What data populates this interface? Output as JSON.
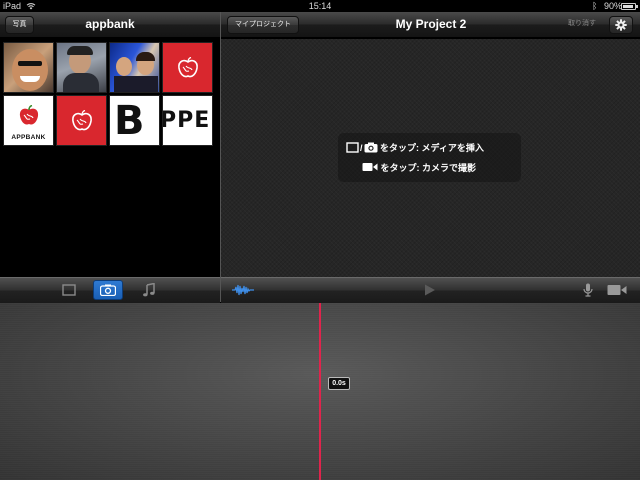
{
  "status_bar": {
    "carrier": "iPad",
    "time": "15:14",
    "battery_text": "90%",
    "battery_level": 0.9
  },
  "media_browser": {
    "back_button_label": "写真",
    "title": "appbank",
    "thumbnails": [
      {
        "kind": "photo"
      },
      {
        "kind": "photo"
      },
      {
        "kind": "photo"
      },
      {
        "kind": "apple-logo"
      },
      {
        "kind": "appbank-logo",
        "text": "APPBANK"
      },
      {
        "kind": "apple-logo"
      },
      {
        "kind": "letter",
        "text": "B"
      },
      {
        "kind": "letters",
        "text": "PPE"
      }
    ],
    "tabs": [
      "video",
      "photo",
      "music"
    ],
    "active_tab": "photo"
  },
  "project": {
    "my_projects_label": "マイプロジェクト",
    "title": "My Project 2",
    "undo_label": "取り消す",
    "hint_line1": "をタップ: メディアを挿入",
    "hint_line2": "をタップ: カメラで撮影"
  },
  "timeline": {
    "time_label": "0.0s"
  },
  "colors": {
    "accent_blue": "#2f7ad2",
    "playhead_red": "#e0244c",
    "thumbnail_red": "#d9272e"
  }
}
